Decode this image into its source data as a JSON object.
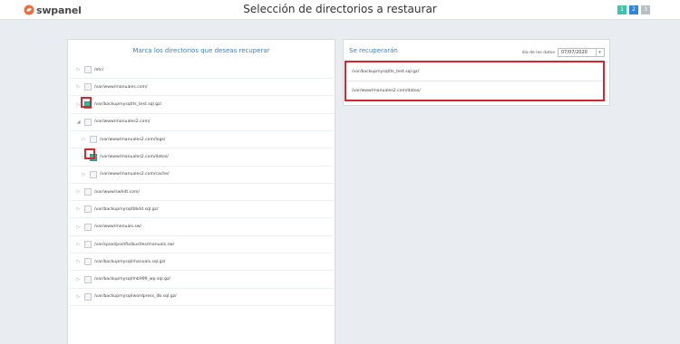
{
  "brand": {
    "name": "swpanel",
    "color": "#f06b3c"
  },
  "title": "Selección de directorios a restaurar",
  "steps": [
    {
      "label": "1",
      "color": "#3fc1b0"
    },
    {
      "label": "2",
      "color": "#2f86d6"
    },
    {
      "label": "3",
      "color": "#b9bec4"
    }
  ],
  "left_panel": {
    "title": "Marca los directorios que deseas recuperar",
    "items": [
      {
        "label": "/etc/",
        "arrow": "right",
        "checked": false,
        "indent": 0
      },
      {
        "label": "/var/www/manuales.com/",
        "arrow": "right",
        "checked": false,
        "indent": 0
      },
      {
        "label": "/var/backupmysql/ts_test.sql.gz/",
        "arrow": "right",
        "checked": true,
        "indent": 0
      },
      {
        "label": "/var/www/manuales2.com/",
        "arrow": "down",
        "checked": false,
        "indent": 0
      },
      {
        "label": "/var/www/manuales2.com/logs/",
        "arrow": "right",
        "checked": false,
        "indent": 1
      },
      {
        "label": "/var/www/manuales2.com/datos/",
        "arrow": "right",
        "checked": true,
        "indent": 1
      },
      {
        "label": "/var/www/manuales2.com/cache/",
        "arrow": "right",
        "checked": false,
        "indent": 1
      },
      {
        "label": "/var/www/swhdt.com/",
        "arrow": "right",
        "checked": false,
        "indent": 0
      },
      {
        "label": "/var/backupmysql/bbdd.sql.gz/",
        "arrow": "right",
        "checked": false,
        "indent": 0
      },
      {
        "label": "/var/www/manuals.sw/",
        "arrow": "right",
        "checked": false,
        "indent": 0
      },
      {
        "label": "/var/spool/postfix/bustles/manuals.sw/",
        "arrow": "right",
        "checked": false,
        "indent": 0
      },
      {
        "label": "/var/backupmysql/manuals.sql.gz/",
        "arrow": "right",
        "checked": false,
        "indent": 0
      },
      {
        "label": "/var/backupmysql/mb999_wp.sql.gz/",
        "arrow": "right",
        "checked": false,
        "indent": 0
      },
      {
        "label": "/var/backupmysql/wordpress_db.sql.gz/",
        "arrow": "right",
        "checked": false,
        "indent": 0
      }
    ]
  },
  "right_panel": {
    "title": "Se recuperarán",
    "date_label": "día de los datos",
    "date_value": "07/07/2020",
    "selected": [
      "/var/backupmysql/ts_test.sql.gz/",
      "/var/www/manuales2.com/datos/"
    ]
  },
  "colors": {
    "accent": "#3a7fc1",
    "highlight": "#d6262b",
    "checked": "#35b59b"
  }
}
